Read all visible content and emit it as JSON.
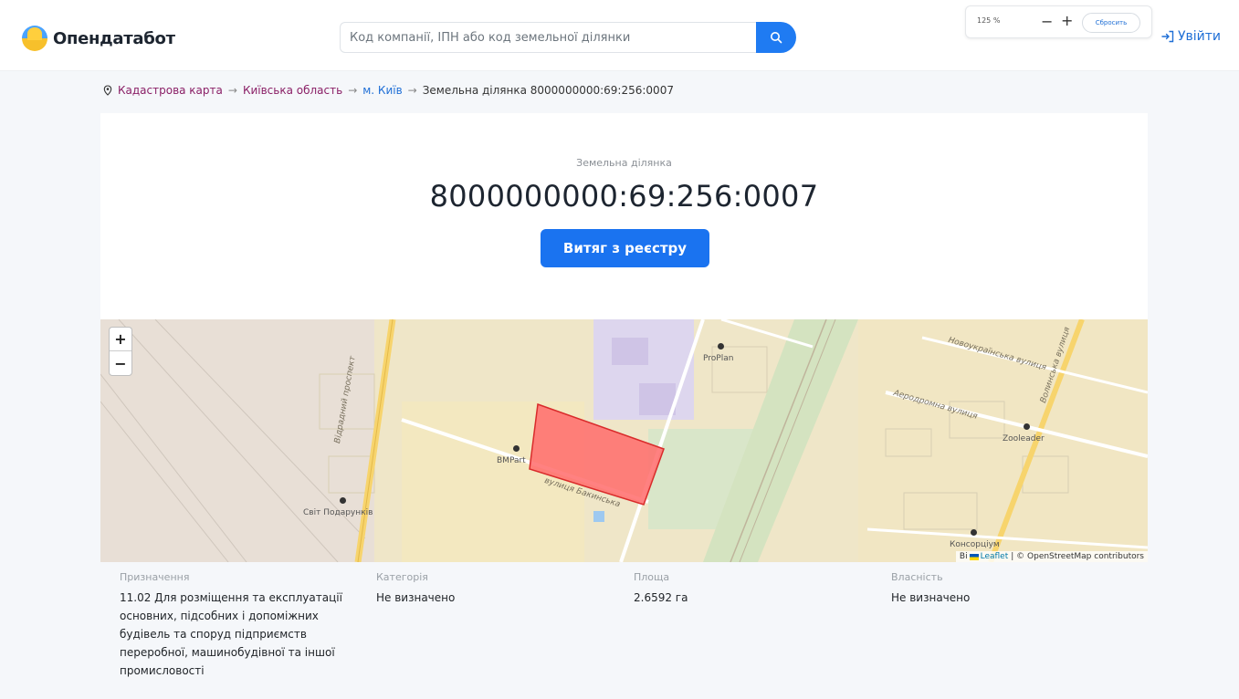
{
  "header": {
    "logo_text": "Опендатабот",
    "search_placeholder": "Код компанії, ІПН або код земельної ділянки",
    "zoom_level": "125 %",
    "zoom_minus": "−",
    "zoom_plus": "+",
    "zoom_reset": "Сбросить",
    "login_label": "Увійти"
  },
  "breadcrumb": {
    "items": [
      "Кадастрова карта",
      "Київська область",
      "м. Київ"
    ],
    "current": "Земельна ділянка 8000000000:69:256:0007",
    "separator": "→"
  },
  "card": {
    "subtitle": "Земельна ділянка",
    "title": "8000000000:69:256:0007",
    "button": "Витяг з реєстру"
  },
  "map": {
    "zoom_in": "+",
    "zoom_out": "−",
    "pois": [
      "ProPlan",
      "BMPart",
      "Світ Подарунків",
      "Zooleader",
      "Консорціум"
    ],
    "streets": [
      "Відрадний проспект",
      "Аеродромна вулиця",
      "Новоукраїнська вулиця",
      "вулиця Бакинська",
      "Волинська вулиця"
    ],
    "attribution_prefix": "Bi",
    "attribution_leaflet": "Leaflet",
    "attribution_rest": "| © OpenStreetMap contributors",
    "parcel_color": "#ff6b6b"
  },
  "info": [
    {
      "label": "Призначення",
      "value": "11.02 Для розміщення та експлуатації основних, підсобних і допоміжних будівель та споруд підприємств переробної, машинобудівної та іншої промисловості"
    },
    {
      "label": "Категорія",
      "value": "Не визначено"
    },
    {
      "label": "Площа",
      "value": "2.6592 га"
    },
    {
      "label": "Власність",
      "value": "Не визначено"
    }
  ],
  "colors": {
    "accent": "#1a73f0",
    "breadcrumb_link": "#8a1f66"
  }
}
